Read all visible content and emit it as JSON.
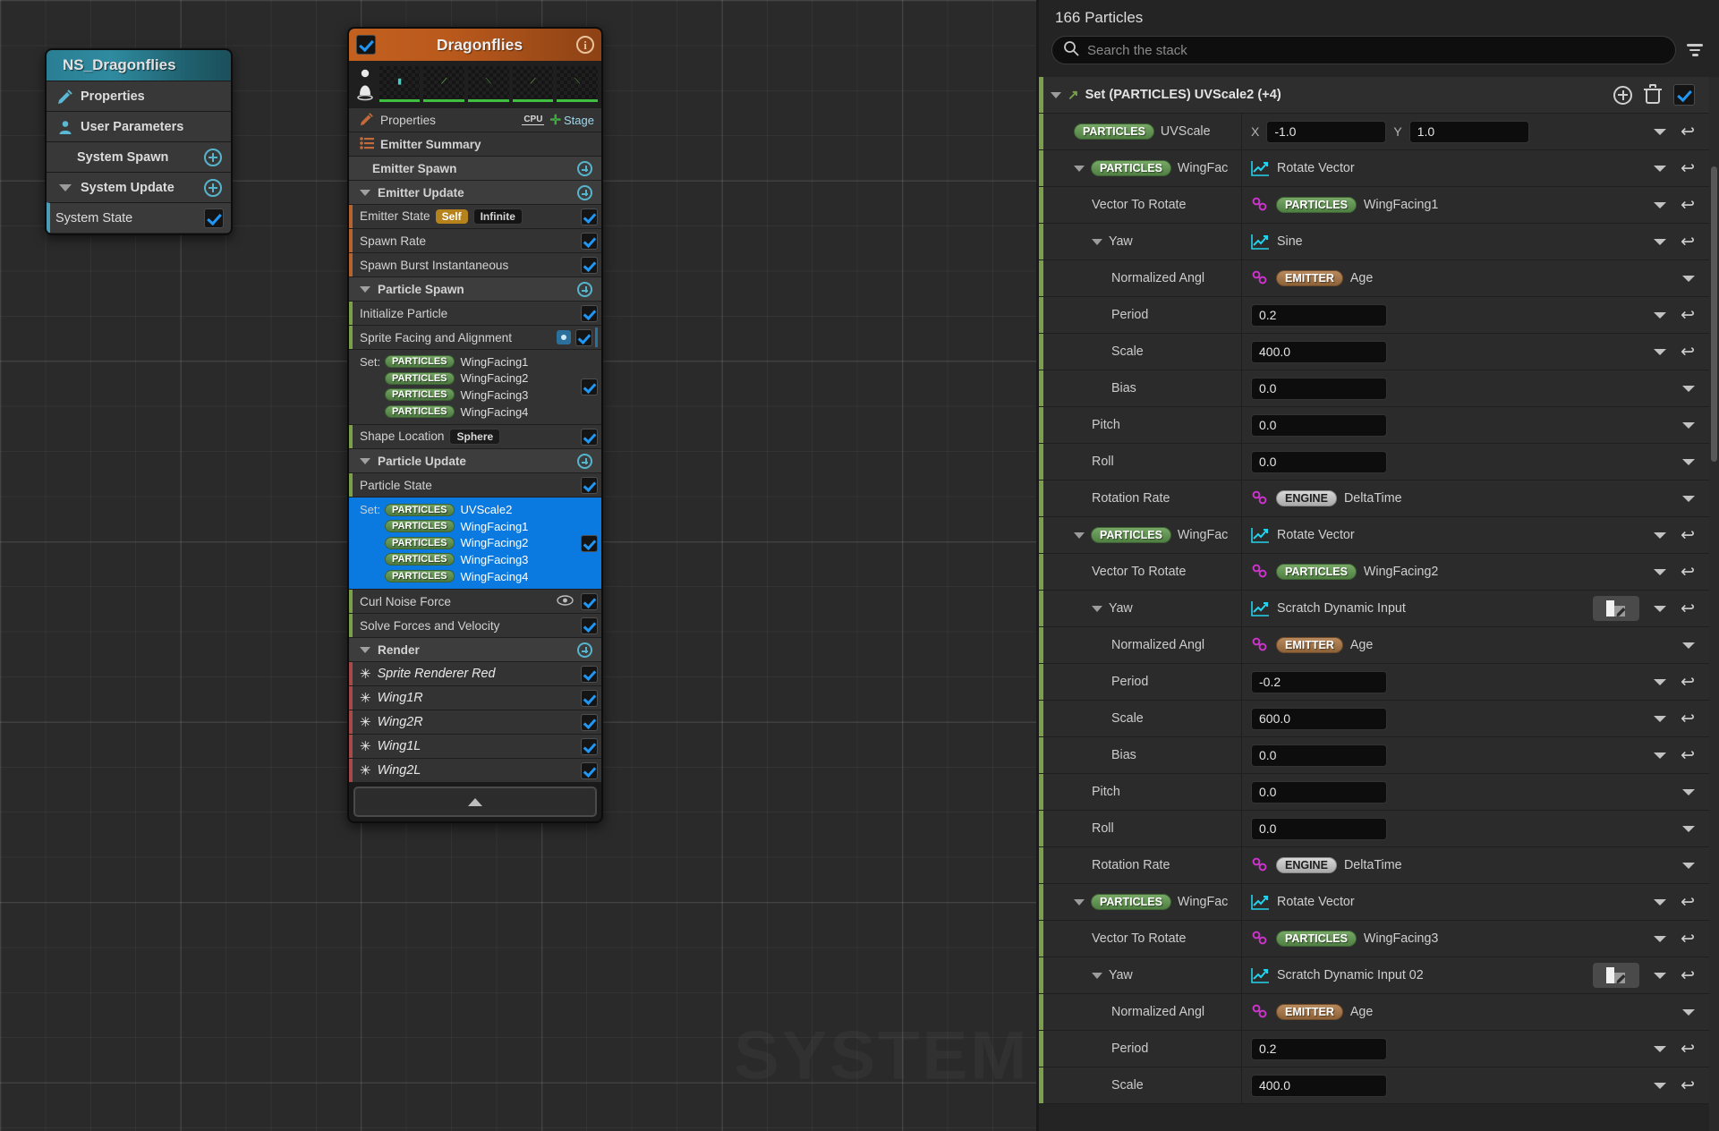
{
  "graph": {
    "watermark": "SYSTEM",
    "system_node": {
      "title": "NS_Dragonflies",
      "rows": [
        {
          "label": "Properties",
          "icon": "properties-pencil-icon",
          "type": "item"
        },
        {
          "label": "User Parameters",
          "icon": "user-icon",
          "type": "item"
        },
        {
          "label": "System Spawn",
          "type": "section",
          "add": "+"
        },
        {
          "label": "System Update",
          "type": "section",
          "add": "+",
          "expanded": true
        },
        {
          "label": "System State",
          "type": "module",
          "checked": true
        }
      ]
    },
    "emitter_node": {
      "title": "Dragonflies",
      "enabled": true,
      "info_icon": "info-icon",
      "thumbnails": [
        "person-scale-icon",
        "thumb-1",
        "thumb-2",
        "thumb-3",
        "thumb-4",
        "thumb-5"
      ],
      "rows": [
        {
          "kind": "item",
          "label": "Properties",
          "icon": "properties-pencil-icon",
          "right": "CPU",
          "stage": "Stage"
        },
        {
          "kind": "item",
          "label": "Emitter Summary",
          "icon": "list-icon"
        },
        {
          "kind": "section",
          "label": "Emitter Spawn",
          "add": "+"
        },
        {
          "kind": "section",
          "label": "Emitter Update",
          "add": "+",
          "expanded": true
        },
        {
          "kind": "module",
          "bar": "orange",
          "label": "Emitter State",
          "pills": [
            "Self",
            "Infinite"
          ],
          "checked": true
        },
        {
          "kind": "module",
          "bar": "orange",
          "label": "Spawn Rate",
          "checked": true
        },
        {
          "kind": "module",
          "bar": "orange",
          "label": "Spawn Burst Instantaneous",
          "checked": true
        },
        {
          "kind": "section",
          "label": "Particle Spawn",
          "add": "+",
          "expanded": true
        },
        {
          "kind": "module",
          "bar": "green",
          "label": "Initialize Particle",
          "checked": true
        },
        {
          "kind": "module",
          "bar": "green",
          "label": "Sprite Facing and Alignment",
          "checked": true,
          "dot": true
        },
        {
          "kind": "setblock",
          "bar": "green",
          "setlabel": "Set:",
          "selected": false,
          "checked": true,
          "entries": [
            {
              "ns": "PARTICLES",
              "attr": "WingFacing1"
            },
            {
              "ns": "PARTICLES",
              "attr": "WingFacing2"
            },
            {
              "ns": "PARTICLES",
              "attr": "WingFacing3"
            },
            {
              "ns": "PARTICLES",
              "attr": "WingFacing4"
            }
          ]
        },
        {
          "kind": "module",
          "bar": "green",
          "label": "Shape Location",
          "pills": [
            "Sphere"
          ],
          "checked": true
        },
        {
          "kind": "section",
          "label": "Particle Update",
          "add": "+",
          "expanded": true
        },
        {
          "kind": "module",
          "bar": "green",
          "label": "Particle State",
          "checked": true
        },
        {
          "kind": "setblock",
          "bar": "green",
          "setlabel": "Set:",
          "selected": true,
          "checked": true,
          "entries": [
            {
              "ns": "PARTICLES",
              "attr": "UVScale2"
            },
            {
              "ns": "PARTICLES",
              "attr": "WingFacing1"
            },
            {
              "ns": "PARTICLES",
              "attr": "WingFacing2"
            },
            {
              "ns": "PARTICLES",
              "attr": "WingFacing3"
            },
            {
              "ns": "PARTICLES",
              "attr": "WingFacing4"
            }
          ]
        },
        {
          "kind": "module",
          "bar": "green",
          "label": "Curl Noise Force",
          "checked": true,
          "eye": true
        },
        {
          "kind": "module",
          "bar": "green",
          "label": "Solve Forces and Velocity",
          "checked": true
        },
        {
          "kind": "section",
          "label": "Render",
          "add": "+",
          "expanded": true
        },
        {
          "kind": "renderer",
          "bar": "red",
          "label": "Sprite Renderer Red",
          "checked": true
        },
        {
          "kind": "renderer",
          "bar": "red",
          "label": "Wing1R",
          "checked": true
        },
        {
          "kind": "renderer",
          "bar": "red",
          "label": "Wing2R",
          "checked": true
        },
        {
          "kind": "renderer",
          "bar": "red",
          "label": "Wing1L",
          "checked": true
        },
        {
          "kind": "renderer",
          "bar": "red",
          "label": "Wing2L",
          "checked": true
        }
      ],
      "collapse_icon": "chevron-up-icon"
    }
  },
  "stack": {
    "title": "166 Particles",
    "search_placeholder": "Search the stack",
    "search_value": "",
    "search_icon": "search-icon",
    "filter_icon": "filter-icon",
    "module_header": {
      "label": "Set (PARTICLES) UVScale2 (+4)",
      "add_icon": "add-icon",
      "delete_icon": "trash-icon",
      "enabled": true
    },
    "rows": [
      {
        "indent": 1,
        "ns": "PARTICLES",
        "name": "UVScale",
        "value_type": "vector2",
        "x_label": "X",
        "x_value": "-1.0",
        "y_label": "Y",
        "y_value": "1.0",
        "chevron": true,
        "undo": true
      },
      {
        "indent": 1,
        "ns": "PARTICLES",
        "name": "WingFac",
        "value_type": "dynamic",
        "value": "Rotate Vector",
        "expand": true,
        "chevron": true,
        "undo": true
      },
      {
        "indent": 2,
        "name": "Vector To Rotate",
        "value_type": "linked",
        "ns_value": "PARTICLES",
        "value": "WingFacing1",
        "chevron": true,
        "undo": true
      },
      {
        "indent": 2,
        "name": "Yaw",
        "value_type": "dynamic",
        "value": "Sine",
        "expand": true,
        "chevron": true,
        "undo": true
      },
      {
        "indent": 3,
        "name": "Normalized Angl",
        "value_type": "linked",
        "ns_value": "EMITTER",
        "value": "Age",
        "chevron": true
      },
      {
        "indent": 3,
        "name": "Period",
        "value_type": "number",
        "value": "0.2",
        "chevron": true,
        "undo": true
      },
      {
        "indent": 3,
        "name": "Scale",
        "value_type": "number",
        "value": "400.0",
        "chevron": true,
        "undo": true
      },
      {
        "indent": 3,
        "name": "Bias",
        "value_type": "number",
        "value": "0.0",
        "chevron": true
      },
      {
        "indent": 2,
        "name": "Pitch",
        "value_type": "number",
        "value": "0.0",
        "chevron": true
      },
      {
        "indent": 2,
        "name": "Roll",
        "value_type": "number",
        "value": "0.0",
        "chevron": true
      },
      {
        "indent": 2,
        "name": "Rotation Rate",
        "value_type": "linked",
        "ns_value": "ENGINE",
        "value": "DeltaTime",
        "chevron": true
      },
      {
        "indent": 1,
        "ns": "PARTICLES",
        "name": "WingFac",
        "value_type": "dynamic",
        "value": "Rotate Vector",
        "expand": true,
        "chevron": true,
        "undo": true
      },
      {
        "indent": 2,
        "name": "Vector To Rotate",
        "value_type": "linked",
        "ns_value": "PARTICLES",
        "value": "WingFacing2",
        "chevron": true,
        "undo": true
      },
      {
        "indent": 2,
        "name": "Yaw",
        "value_type": "dynamic",
        "value": "Scratch Dynamic Input",
        "expand": true,
        "edit": true,
        "chevron": true,
        "undo": true
      },
      {
        "indent": 3,
        "name": "Normalized Angl",
        "value_type": "linked",
        "ns_value": "EMITTER",
        "value": "Age",
        "chevron": true
      },
      {
        "indent": 3,
        "name": "Period",
        "value_type": "number",
        "value": "-0.2",
        "chevron": true,
        "undo": true
      },
      {
        "indent": 3,
        "name": "Scale",
        "value_type": "number",
        "value": "600.0",
        "chevron": true,
        "undo": true
      },
      {
        "indent": 3,
        "name": "Bias",
        "value_type": "number",
        "value": "0.0",
        "chevron": true,
        "undo": true
      },
      {
        "indent": 2,
        "name": "Pitch",
        "value_type": "number",
        "value": "0.0",
        "chevron": true
      },
      {
        "indent": 2,
        "name": "Roll",
        "value_type": "number",
        "value": "0.0",
        "chevron": true
      },
      {
        "indent": 2,
        "name": "Rotation Rate",
        "value_type": "linked",
        "ns_value": "ENGINE",
        "value": "DeltaTime",
        "chevron": true
      },
      {
        "indent": 1,
        "ns": "PARTICLES",
        "name": "WingFac",
        "value_type": "dynamic",
        "value": "Rotate Vector",
        "expand": true,
        "chevron": true,
        "undo": true
      },
      {
        "indent": 2,
        "name": "Vector To Rotate",
        "value_type": "linked",
        "ns_value": "PARTICLES",
        "value": "WingFacing3",
        "chevron": true,
        "undo": true
      },
      {
        "indent": 2,
        "name": "Yaw",
        "value_type": "dynamic",
        "value": "Scratch Dynamic Input 02",
        "expand": true,
        "edit": true,
        "chevron": true,
        "undo": true
      },
      {
        "indent": 3,
        "name": "Normalized Angl",
        "value_type": "linked",
        "ns_value": "EMITTER",
        "value": "Age",
        "chevron": true
      },
      {
        "indent": 3,
        "name": "Period",
        "value_type": "number",
        "value": "0.2",
        "chevron": true,
        "undo": true
      },
      {
        "indent": 3,
        "name": "Scale",
        "value_type": "number",
        "value": "400.0",
        "chevron": true,
        "undo": true
      }
    ]
  },
  "colors": {
    "accent_blue": "#2196f3",
    "selection_blue": "#0b7ae0",
    "particles_green": "#5f8f4d",
    "emitter_tan": "#a0743f",
    "emitter_orange": "#b9591c",
    "system_teal": "#2a7e93",
    "link_magenta": "#cc33cc",
    "curve_cyan": "#22d3ee"
  }
}
